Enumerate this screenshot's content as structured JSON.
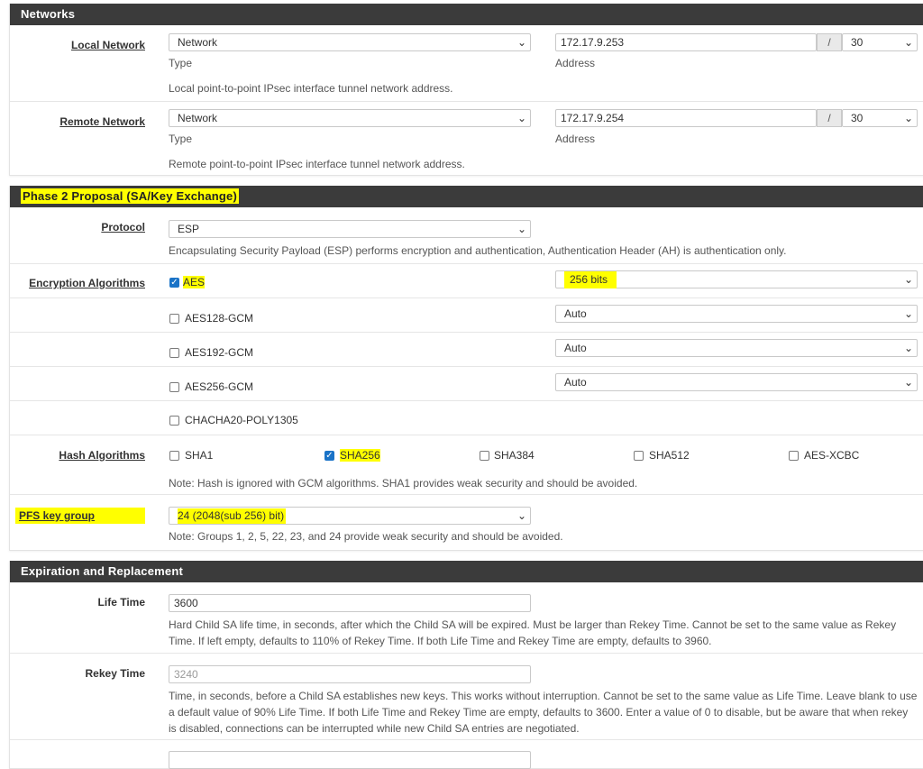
{
  "networks": {
    "title": "Networks",
    "local": {
      "label": "Local Network",
      "type_value": "Network",
      "type_caption": "Type",
      "address": "172.17.9.253",
      "address_caption": "Address",
      "slash": "/",
      "prefix": "30",
      "help": "Local point-to-point IPsec interface tunnel network address."
    },
    "remote": {
      "label": "Remote Network",
      "type_value": "Network",
      "type_caption": "Type",
      "address": "172.17.9.254",
      "address_caption": "Address",
      "slash": "/",
      "prefix": "30",
      "help": "Remote point-to-point IPsec interface tunnel network address."
    }
  },
  "phase2": {
    "title": "Phase 2 Proposal (SA/Key Exchange)",
    "protocol": {
      "label": "Protocol",
      "value": "ESP",
      "help": "Encapsulating Security Payload (ESP) performs encryption and authentication, Authentication Header (AH) is authentication only."
    },
    "encryption": {
      "label": "Encryption Algorithms",
      "items": [
        {
          "name": "AES",
          "checked": true,
          "keylen": "256 bits"
        },
        {
          "name": "AES128-GCM",
          "checked": false,
          "keylen": "Auto"
        },
        {
          "name": "AES192-GCM",
          "checked": false,
          "keylen": "Auto"
        },
        {
          "name": "AES256-GCM",
          "checked": false,
          "keylen": "Auto"
        },
        {
          "name": "CHACHA20-POLY1305",
          "checked": false,
          "keylen": ""
        }
      ]
    },
    "hash": {
      "label": "Hash Algorithms",
      "items": [
        {
          "name": "SHA1",
          "checked": false
        },
        {
          "name": "SHA256",
          "checked": true
        },
        {
          "name": "SHA384",
          "checked": false
        },
        {
          "name": "SHA512",
          "checked": false
        },
        {
          "name": "AES-XCBC",
          "checked": false
        }
      ],
      "help": "Note: Hash is ignored with GCM algorithms. SHA1 provides weak security and should be avoided."
    },
    "pfs": {
      "label": "PFS key group",
      "value": "24 (2048(sub 256) bit)",
      "help": "Note: Groups 1, 2, 5, 22, 23, and 24 provide weak security and should be avoided."
    }
  },
  "expiration": {
    "title": "Expiration and Replacement",
    "lifetime": {
      "label": "Life Time",
      "value": "3600",
      "help": "Hard Child SA life time, in seconds, after which the Child SA will be expired. Must be larger than Rekey Time. Cannot be set to the same value as Rekey Time. If left empty, defaults to 110% of Rekey Time. If both Life Time and Rekey Time are empty, defaults to 3960."
    },
    "rekey": {
      "label": "Rekey Time",
      "placeholder": "3240",
      "help": "Time, in seconds, before a Child SA establishes new keys. This works without interruption. Cannot be set to the same value as Life Time. Leave blank to use a default value of 90% Life Time. If both Life Time and Rekey Time are empty, defaults to 3600. Enter a value of 0 to disable, but be aware that when rekey is disabled, connections can be interrupted while new Child SA entries are negotiated."
    }
  },
  "colors": {
    "header_bg": "#3b3b3b",
    "highlight": "#ffff00",
    "checkbox_checked": "#1a73c7"
  }
}
